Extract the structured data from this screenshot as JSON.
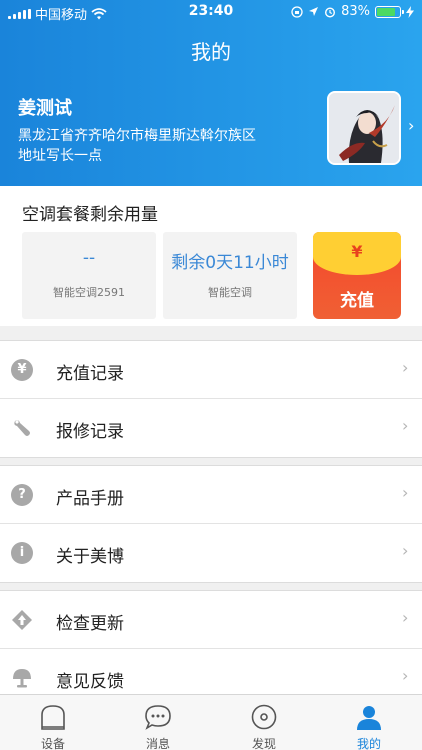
{
  "status_bar": {
    "carrier": "中国移动",
    "time": "23:40",
    "battery": "83%",
    "battery_level": 0.83,
    "icons": [
      "wifi-icon",
      "orientation-lock-icon",
      "location-icon",
      "alarm-icon",
      "charging-bolt-icon"
    ]
  },
  "header": {
    "title": "我的"
  },
  "profile": {
    "name": "姜测试",
    "address": "黑龙江省齐齐哈尔市梅里斯达斡尔族区地址写长一点",
    "chevron": "›"
  },
  "usage": {
    "title": "空调套餐剩余用量",
    "tiles": [
      {
        "value": "--",
        "label": "智能空调2591"
      },
      {
        "value": "剩余0天11小时",
        "label": "智能空调"
      }
    ],
    "recharge": {
      "symbol": "¥",
      "label": "充值"
    }
  },
  "menu": {
    "chevron": "›",
    "groups": [
      [
        {
          "label": "充值记录",
          "icon": "yen-circle-icon",
          "glyph": "¥"
        },
        {
          "label": "报修记录",
          "icon": "wrench-icon"
        }
      ],
      [
        {
          "label": "产品手册",
          "icon": "question-circle-icon",
          "glyph": "?"
        },
        {
          "label": "关于美博",
          "icon": "info-circle-icon",
          "glyph": "i"
        }
      ],
      [
        {
          "label": "检查更新",
          "icon": "update-arrow-icon"
        },
        {
          "label": "意见反馈",
          "icon": "feedback-lamp-icon"
        }
      ]
    ]
  },
  "tabbar": {
    "tabs": [
      {
        "label": "设备",
        "icon": "device-icon",
        "active": false
      },
      {
        "label": "消息",
        "icon": "message-bubble-icon",
        "active": false
      },
      {
        "label": "发现",
        "icon": "discover-icon",
        "active": false
      },
      {
        "label": "我的",
        "icon": "person-icon",
        "active": true
      }
    ]
  },
  "colors": {
    "header_start": "#1a84da",
    "header_end": "#2aa4ee",
    "accent": "#3a88d6",
    "recharge_red": "#f4472c",
    "recharge_yellow": "#ffcf33",
    "icon_gray": "#a8a8a8"
  }
}
